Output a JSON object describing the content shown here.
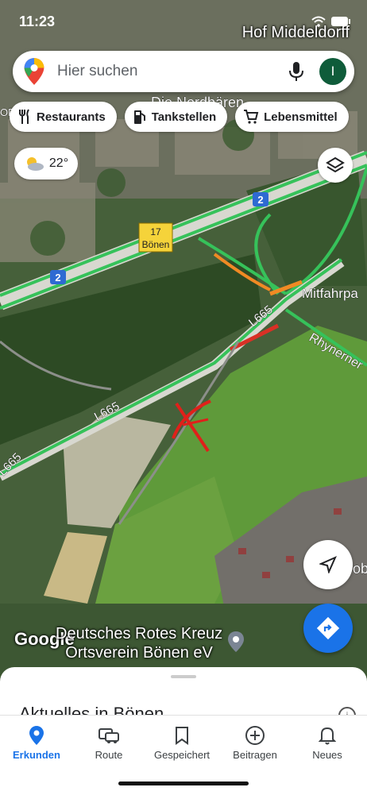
{
  "status_bar": {
    "time": "11:23"
  },
  "map": {
    "place_top": "Hof Middeldorff",
    "labels": {
      "die_nordbaren": "Die Nordbären",
      "mitfahr": "Mitfahrpa",
      "rhynerner": "Rhynerner",
      "l665_a": "L665",
      "l665_b": "L665",
      "l665_c": "L665",
      "badge_2_a": "2",
      "badge_2_b": "2",
      "exit_num": "17",
      "exit_name": "Bönen",
      "edge_or": "OR",
      "edge_ob": "ob"
    },
    "google_logo": "Google",
    "poi": {
      "line1": "Deutsches Rotes Kreuz",
      "line2": "Ortsverein Bönen eV"
    }
  },
  "search": {
    "placeholder": "Hier suchen",
    "avatar_letter": "I"
  },
  "chips": [
    {
      "label": "Restaurants",
      "icon": "fork-knife-icon"
    },
    {
      "label": "Tankstellen",
      "icon": "gas-pump-icon"
    },
    {
      "label": "Lebensmittel",
      "icon": "shopping-cart-icon"
    }
  ],
  "weather": {
    "temp": "22°",
    "icon": "partly-cloudy-icon"
  },
  "sheet": {
    "title": "Aktuelles in Bönen"
  },
  "nav": [
    {
      "label": "Erkunden",
      "icon": "location-pin-icon",
      "active": true
    },
    {
      "label": "Route",
      "icon": "car-icon",
      "active": false
    },
    {
      "label": "Gespeichert",
      "icon": "bookmark-icon",
      "active": false
    },
    {
      "label": "Beitragen",
      "icon": "plus-circle-icon",
      "active": false
    },
    {
      "label": "Neues",
      "icon": "bell-icon",
      "active": false
    }
  ],
  "colors": {
    "accent": "#1a73e8",
    "avatar": "#0f5c3a",
    "road_green": "#36c25a",
    "traffic_orange": "#f08a24",
    "traffic_red": "#d93025"
  }
}
